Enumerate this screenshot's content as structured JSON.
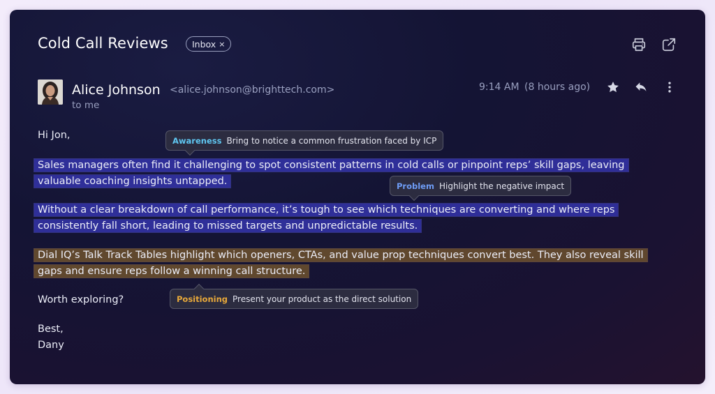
{
  "email": {
    "subject": "Cold Call Reviews",
    "label_chip": "Inbox",
    "label_chip_close": "×",
    "sender_name": "Alice Johnson",
    "sender_email": "<alice.johnson@brighttech.com>",
    "recipient": "to me",
    "time": "9:14 AM",
    "time_ago": "(8 hours ago)",
    "greeting": "Hi Jon,",
    "paragraphs": [
      "Sales managers often find it challenging to spot consistent patterns in cold calls or pinpoint reps’ skill gaps, leaving valuable coaching insights untapped.",
      "Without a clear breakdown of call performance, it’s tough to see which techniques are converting and where reps consistently fall short, leading to missed targets and unpredictable results.",
      "Dial IQ’s Talk Track Tables highlight which openers, CTAs, and value prop techniques convert best. They also reveal skill gaps and ensure reps follow a winning call structure."
    ],
    "closing_question": "Worth exploring?",
    "signoff": "Best,",
    "signature": "Dany"
  },
  "annotations": [
    {
      "tag": "Awareness",
      "text": "Bring to notice a common frustration faced by ICP",
      "color": "#5fc6f0"
    },
    {
      "tag": "Problem",
      "text": "Highlight the negative impact",
      "color": "#6e9cf5"
    },
    {
      "tag": "Positioning",
      "text": "Present your product as the direct solution",
      "color": "#e8a93a"
    }
  ],
  "icons": [
    "print-icon",
    "open-in-new-icon",
    "star-icon",
    "reply-icon",
    "more-vertical-icon",
    "close-icon"
  ],
  "colors": {
    "highlight_blue": "#2e2ea0",
    "highlight_tan": "#684e2e"
  }
}
